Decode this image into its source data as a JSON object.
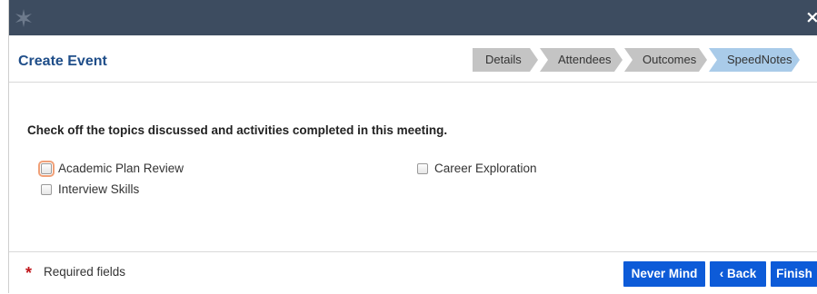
{
  "window": {
    "close_glyph": "×"
  },
  "header": {
    "title": "Create Event",
    "steps": [
      "Details",
      "Attendees",
      "Outcomes",
      "SpeedNotes"
    ],
    "active_step": "SpeedNotes"
  },
  "main": {
    "instruction": "Check off the topics discussed and activities completed in this meeting.",
    "topics": [
      {
        "label": "Academic Plan Review",
        "checked": false,
        "focused": true
      },
      {
        "label": "Career Exploration",
        "checked": false
      },
      {
        "label": "Interview Skills",
        "checked": false
      }
    ]
  },
  "footer": {
    "required_marker": "*",
    "required_label": "Required fields",
    "buttons": {
      "never_mind": "Never Mind",
      "back": "‹ Back",
      "finish": "Finish"
    }
  },
  "colors": {
    "titlebar": "#3d4c60",
    "title_text": "#1f4e89",
    "step_inactive": "#c4c4c4",
    "step_active": "#a9cbe9",
    "primary_button": "#0d5bd8",
    "required_star": "#c0171c"
  }
}
